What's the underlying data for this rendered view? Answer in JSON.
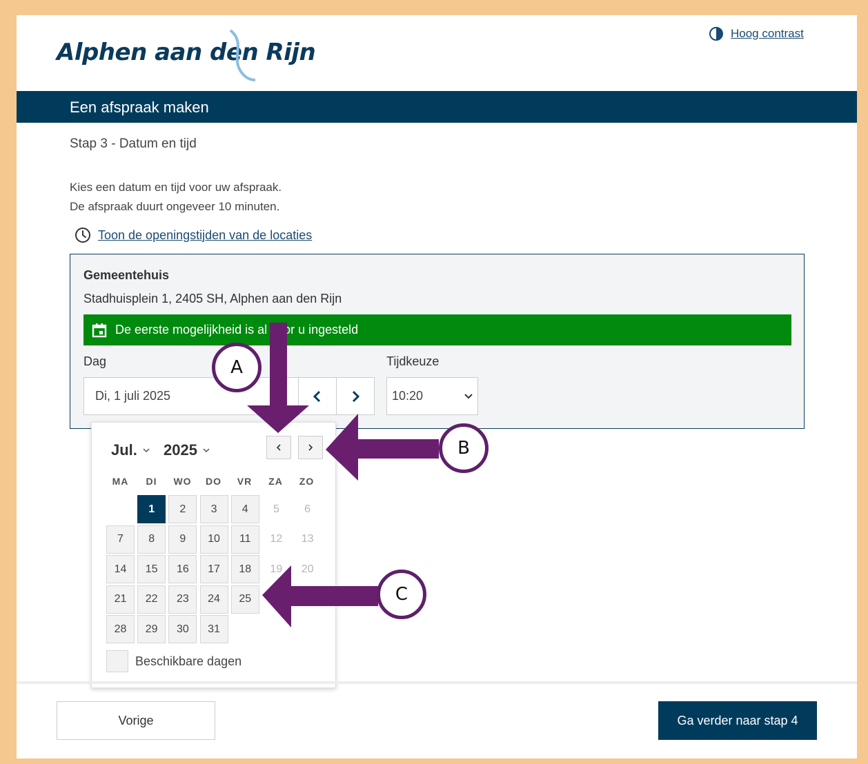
{
  "header": {
    "logo_text": "Alphen aan den Rijn",
    "contrast_label": "Hoog contrast",
    "page_title": "Een afspraak maken"
  },
  "step": "Stap 3 - Datum en tijd",
  "intro": {
    "line1": "Kies een datum en tijd voor uw afspraak.",
    "line2": "De afspraak duurt ongeveer 10 minuten."
  },
  "opening_hours_link": "Toon de openingstijden van de locaties",
  "location": {
    "name": "Gemeentehuis",
    "address": "Stadhuisplein 1, 2405 SH, Alphen aan den Rijn",
    "notice": "De eerste mogelijkheid is al voor u ingesteld",
    "day_label": "Dag",
    "day_value": "Di, 1 juli 2025",
    "time_label": "Tijdkeuze",
    "time_value": "10:20"
  },
  "calendar": {
    "month": "Jul.",
    "year": "2025",
    "weekdays": [
      "MA",
      "DI",
      "WO",
      "DO",
      "VR",
      "ZA",
      "ZO"
    ],
    "weeks": [
      [
        {
          "d": "",
          "s": "empty"
        },
        {
          "d": "1",
          "s": "sel"
        },
        {
          "d": "2",
          "s": "avail"
        },
        {
          "d": "3",
          "s": "avail"
        },
        {
          "d": "4",
          "s": "avail"
        },
        {
          "d": "5",
          "s": "dis"
        },
        {
          "d": "6",
          "s": "dis"
        }
      ],
      [
        {
          "d": "7",
          "s": "avail"
        },
        {
          "d": "8",
          "s": "avail"
        },
        {
          "d": "9",
          "s": "avail"
        },
        {
          "d": "10",
          "s": "avail"
        },
        {
          "d": "11",
          "s": "avail"
        },
        {
          "d": "12",
          "s": "dis"
        },
        {
          "d": "13",
          "s": "dis"
        }
      ],
      [
        {
          "d": "14",
          "s": "avail"
        },
        {
          "d": "15",
          "s": "avail"
        },
        {
          "d": "16",
          "s": "avail"
        },
        {
          "d": "17",
          "s": "avail"
        },
        {
          "d": "18",
          "s": "avail"
        },
        {
          "d": "19",
          "s": "dis"
        },
        {
          "d": "20",
          "s": "dis"
        }
      ],
      [
        {
          "d": "21",
          "s": "avail"
        },
        {
          "d": "22",
          "s": "avail"
        },
        {
          "d": "23",
          "s": "avail"
        },
        {
          "d": "24",
          "s": "avail"
        },
        {
          "d": "25",
          "s": "avail"
        },
        {
          "d": "",
          "s": "empty"
        },
        {
          "d": "",
          "s": "empty"
        }
      ],
      [
        {
          "d": "28",
          "s": "avail"
        },
        {
          "d": "29",
          "s": "avail"
        },
        {
          "d": "30",
          "s": "avail"
        },
        {
          "d": "31",
          "s": "avail"
        },
        {
          "d": "",
          "s": "empty"
        },
        {
          "d": "",
          "s": "empty"
        },
        {
          "d": "",
          "s": "empty"
        }
      ]
    ],
    "legend": "Beschikbare dagen"
  },
  "footer": {
    "prev_label": "Vorige",
    "next_label": "Ga verder naar stap 4"
  },
  "annotations": {
    "a": "A",
    "b": "B",
    "c": "C",
    "arrow_color": "#6a1f6e"
  },
  "colors": {
    "brand_navy": "#003b5c",
    "notice_green": "#008a0e",
    "frame_border": "#f4c88f"
  }
}
